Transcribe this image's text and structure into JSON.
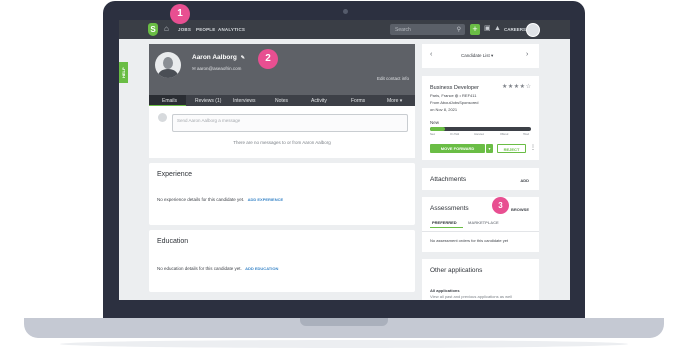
{
  "topbar": {
    "logo_letter": "S",
    "nav": [
      "JOBS",
      "PEOPLE",
      "ANALYTICS"
    ],
    "search_placeholder": "Search",
    "careers_label": "CAREERS"
  },
  "help_label": "HELP",
  "candidate": {
    "name": "Aaron Aalborg",
    "email": "aaron@aseaofrin.com",
    "edit_contact": "Edit contact info"
  },
  "tabs": [
    "Emails",
    "Reviews (1)",
    "Interviews",
    "Notes",
    "Activity",
    "Forms",
    "More"
  ],
  "messages": {
    "placeholder": "Send Aaron Aalborg a message",
    "empty_text": "There are no messages to or from Aaron Aalborg"
  },
  "experience": {
    "title": "Experience",
    "text": "No experience details for this candidate yet.",
    "link": "ADD EXPERIENCE"
  },
  "education": {
    "title": "Education",
    "text": "No education details for this candidate yet.",
    "link": "ADD EDUCATION"
  },
  "pager": {
    "label": "Candidate List"
  },
  "job": {
    "title": "Business Developer",
    "location_line": "Paris, France",
    "ref": "REF411",
    "source": "From AboutJobsSponsored",
    "date": "on Nov 8, 2021",
    "rating": 4,
    "stage": "New",
    "progress": 0.15,
    "stage_labels": [
      "New",
      "On Hold",
      "Interview",
      "Offered",
      "Hired"
    ],
    "move_label": "MOVE FORWARD",
    "reject_label": "REJECT"
  },
  "attachments": {
    "title": "Attachments",
    "action": "ADD"
  },
  "assessments": {
    "title": "Assessments",
    "action": "BROWSE",
    "tabs": [
      "PREFERRED",
      "MARKETPLACE"
    ],
    "empty_text": "No assessment orders for this candidate yet"
  },
  "other_apps": {
    "title": "Other applications",
    "subtitle": "All applications",
    "text": "View all past and previous applications as well"
  },
  "markers": [
    "1",
    "2",
    "3"
  ],
  "colors": {
    "brand_green": "#6abd45",
    "marker_pink": "#e84f91",
    "topbar": "#3a3e46",
    "laptop_frame": "#2c3040"
  }
}
